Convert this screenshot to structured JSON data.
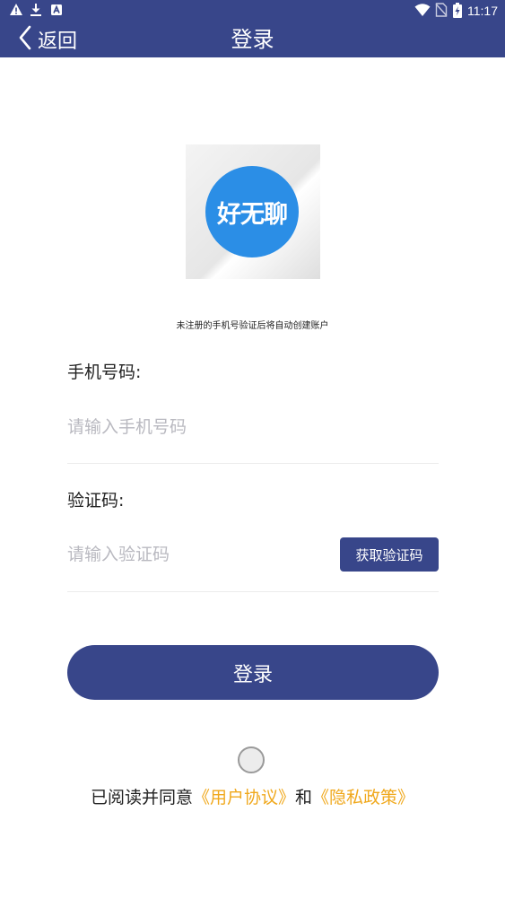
{
  "status_bar": {
    "time": "11:17",
    "icons": [
      "warning-icon",
      "download-icon",
      "app-notification-icon",
      "wifi-icon",
      "no-sim-icon",
      "battery-charging-icon"
    ]
  },
  "header": {
    "back_label": "返回",
    "title": "登录"
  },
  "logo": {
    "text": "好无聊",
    "circle_color": "#2b8ee6"
  },
  "hint": "未注册的手机号验证后将自动创建账户",
  "phone": {
    "label": "手机号码:",
    "placeholder": "请输入手机号码",
    "value": ""
  },
  "code": {
    "label": "验证码:",
    "placeholder": "请输入验证码",
    "value": "",
    "get_code_label": "获取验证码"
  },
  "login_button": "登录",
  "agreement": {
    "prefix": "已阅读并同意",
    "user_agreement": "《用户协议》",
    "conjunction": "和",
    "privacy_policy": "《隐私政策》",
    "checked": false
  },
  "colors": {
    "primary": "#38468a",
    "link": "#f0a81c",
    "placeholder": "#b9b9c0"
  }
}
